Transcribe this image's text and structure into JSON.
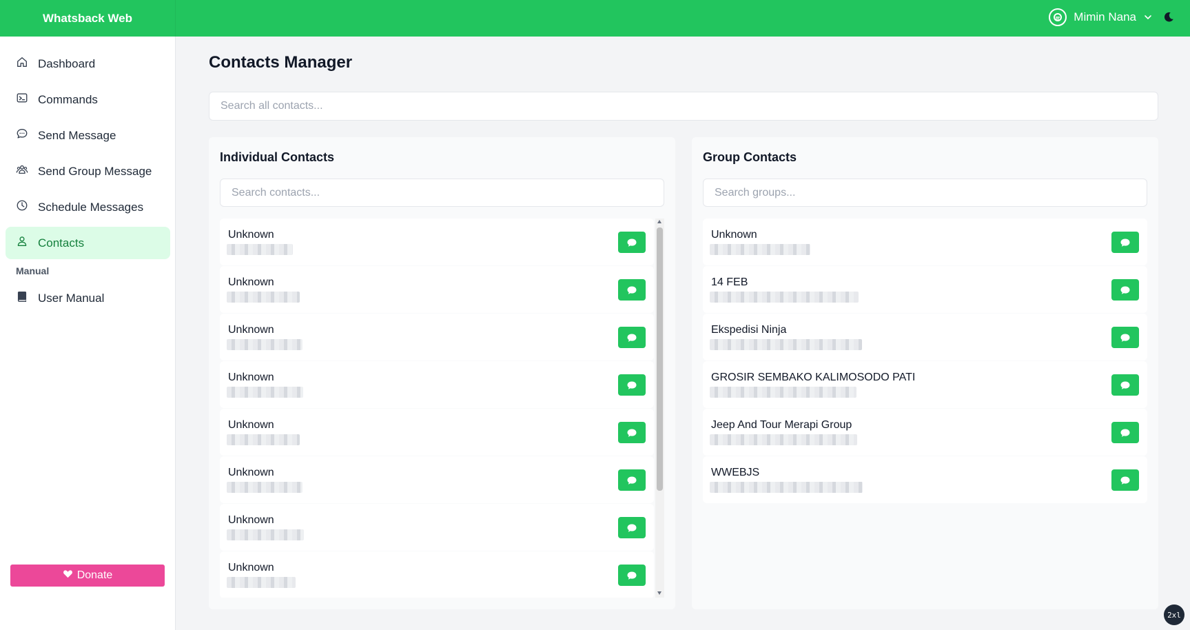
{
  "app": {
    "title": "Whatsback Web"
  },
  "user": {
    "name": "Mimin Nana"
  },
  "sidebar": {
    "items": [
      {
        "label": "Dashboard",
        "icon": "home-icon"
      },
      {
        "label": "Commands",
        "icon": "terminal-icon"
      },
      {
        "label": "Send Message",
        "icon": "chat-icon"
      },
      {
        "label": "Send Group Message",
        "icon": "users-icon"
      },
      {
        "label": "Schedule Messages",
        "icon": "clock-icon"
      },
      {
        "label": "Contacts",
        "icon": "user-icon",
        "active": true
      }
    ],
    "section_label": "Manual",
    "manual_items": [
      {
        "label": "User Manual",
        "icon": "book-icon"
      }
    ],
    "donate_label": "Donate"
  },
  "main": {
    "title": "Contacts Manager",
    "search_placeholder": "Search all contacts...",
    "individual": {
      "title": "Individual Contacts",
      "search_placeholder": "Search contacts...",
      "contacts": [
        {
          "name": "Unknown"
        },
        {
          "name": "Unknown"
        },
        {
          "name": "Unknown"
        },
        {
          "name": "Unknown"
        },
        {
          "name": "Unknown"
        },
        {
          "name": "Unknown"
        },
        {
          "name": "Unknown"
        },
        {
          "name": "Unknown"
        }
      ]
    },
    "groups": {
      "title": "Group Contacts",
      "search_placeholder": "Search groups...",
      "contacts": [
        {
          "name": "Unknown"
        },
        {
          "name": "14 FEB"
        },
        {
          "name": "Ekspedisi Ninja"
        },
        {
          "name": "GROSIR SEMBAKO KALIMOSODO PATI"
        },
        {
          "name": "Jeep And Tour Merapi Group"
        },
        {
          "name": "WWEBJS"
        }
      ]
    }
  },
  "corner_badge": "2xl",
  "colors": {
    "brand": "#22c55e",
    "active_bg": "#dcfce7",
    "active_text": "#15803d",
    "donate": "#ec4899"
  }
}
